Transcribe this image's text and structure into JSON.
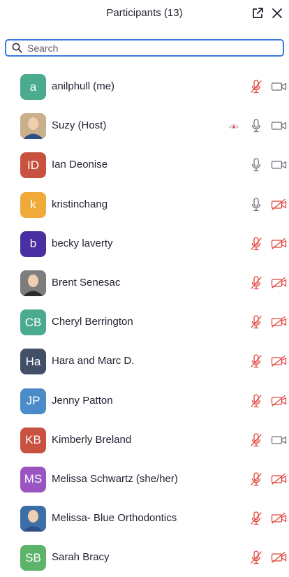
{
  "header": {
    "title": "Participants (13)"
  },
  "search": {
    "placeholder": "Search"
  },
  "participants": [
    {
      "name": "anilphull (me)",
      "initials": "a",
      "color": "#4aab8e",
      "photo": false,
      "host": false,
      "mic": "muted",
      "video": "on"
    },
    {
      "name": "Suzy (Host)",
      "initials": "",
      "color": "#c9b08a",
      "photo": true,
      "host": true,
      "mic": "on",
      "video": "on"
    },
    {
      "name": "Ian Deonise",
      "initials": "ID",
      "color": "#c8523f",
      "photo": false,
      "host": false,
      "mic": "on",
      "video": "on"
    },
    {
      "name": "kristinchang",
      "initials": "k",
      "color": "#efaa3a",
      "photo": false,
      "host": false,
      "mic": "on",
      "video": "off"
    },
    {
      "name": "becky laverty",
      "initials": "b",
      "color": "#4a2fa3",
      "photo": false,
      "host": false,
      "mic": "muted",
      "video": "off"
    },
    {
      "name": "Brent Senesac",
      "initials": "",
      "color": "#7d7d7d",
      "photo": true,
      "host": false,
      "mic": "muted",
      "video": "off"
    },
    {
      "name": "Cheryl Berrington",
      "initials": "CB",
      "color": "#4aab8e",
      "photo": false,
      "host": false,
      "mic": "muted",
      "video": "off"
    },
    {
      "name": "Hara and Marc D.",
      "initials": "Ha",
      "color": "#415067",
      "photo": false,
      "host": false,
      "mic": "muted",
      "video": "off"
    },
    {
      "name": "Jenny Patton",
      "initials": "JP",
      "color": "#4b8cc8",
      "photo": false,
      "host": false,
      "mic": "muted",
      "video": "off"
    },
    {
      "name": "Kimberly Breland",
      "initials": "KB",
      "color": "#c8523f",
      "photo": false,
      "host": false,
      "mic": "muted",
      "video": "on"
    },
    {
      "name": "Melissa Schwartz (she/her)",
      "initials": "MS",
      "color": "#9b55c2",
      "photo": false,
      "host": false,
      "mic": "muted",
      "video": "off"
    },
    {
      "name": "Melissa- Blue Orthodontics",
      "initials": "",
      "color": "#3b6fa8",
      "photo": true,
      "host": false,
      "mic": "muted",
      "video": "off"
    },
    {
      "name": "Sarah Bracy",
      "initials": "SB",
      "color": "#5bb46a",
      "photo": false,
      "host": false,
      "mic": "muted",
      "video": "off"
    }
  ],
  "colors": {
    "muted": "#e0443a",
    "icon": "#6e6e7a",
    "accent": "#3b7be0"
  }
}
